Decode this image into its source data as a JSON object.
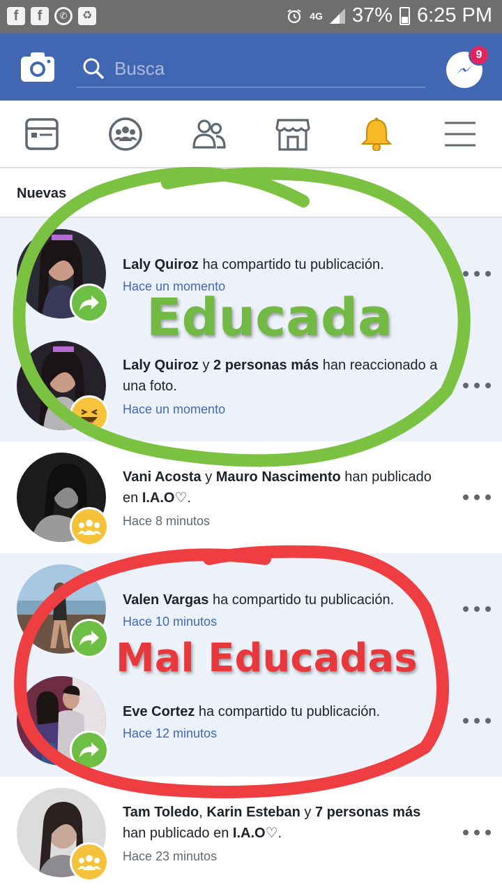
{
  "status_bar": {
    "icons": [
      "facebook-icon",
      "facebook-icon",
      "whatsapp-icon",
      "recycle-icon"
    ],
    "network": "4G",
    "battery": "37%",
    "time": "6:25 PM"
  },
  "header": {
    "search_placeholder": "Busca",
    "messenger_badge": "9",
    "brand_color": "#4267b2"
  },
  "nav": {
    "items": [
      "news-feed-icon",
      "groups-icon",
      "friends-icon",
      "marketplace-icon",
      "notifications-bell-icon",
      "menu-icon"
    ]
  },
  "section": {
    "title": "Nuevas"
  },
  "notifications": [
    {
      "state": "unread",
      "badge": "share",
      "actor1": "Laly Quiroz",
      "middle": " ha compartido tu publicación.",
      "time": "Hace un momento"
    },
    {
      "state": "unread",
      "badge": "haha",
      "actor1": "Laly Quiroz",
      "connector": " y ",
      "actor2": "2 personas más",
      "middle": " han reaccionado a una foto.",
      "time": "Hace un momento"
    },
    {
      "state": "read",
      "badge": "group",
      "actor1": "Vani Acosta",
      "connector": " y ",
      "actor2": "Mauro Nascimento",
      "middle": " han publicado en ",
      "group": "I.A.O♡",
      "end": ".",
      "time": "Hace 8 minutos"
    },
    {
      "state": "unread",
      "badge": "share",
      "actor1": "Valen Vargas",
      "middle": " ha compartido tu publicación.",
      "time": "Hace 10 minutos"
    },
    {
      "state": "unread",
      "badge": "share",
      "actor1": "Eve Cortez",
      "middle": " ha compartido tu publicación.",
      "time": "Hace 12 minutos"
    },
    {
      "state": "read",
      "badge": "group",
      "actor1": "Tam Toledo",
      "connector": ", ",
      "actor2": "Karin Esteban",
      "connector2": " y ",
      "actor3": "7 personas más",
      "middle": " han publicado en ",
      "group": "I.A.O♡",
      "end": ".",
      "time": "Hace 23 minutos"
    }
  ],
  "annotations": {
    "green_label": "Educada",
    "red_label": "Mal Educadas",
    "green_color": "#71b943",
    "red_color": "#e8383c"
  }
}
